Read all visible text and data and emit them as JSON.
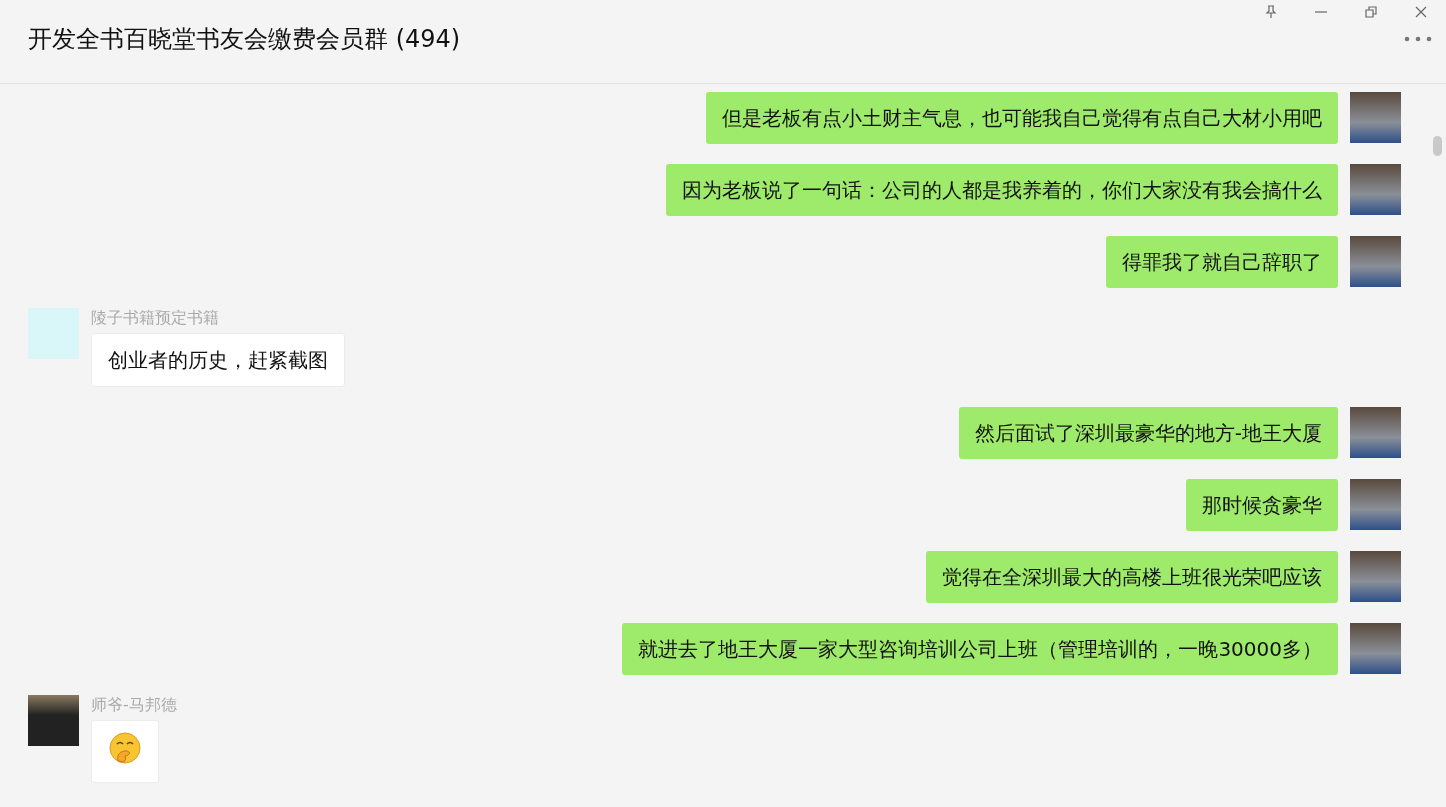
{
  "window": {
    "title": "开发全书百晓堂书友会缴费会员群 (494)"
  },
  "messages": [
    {
      "kind": "mine",
      "text": "但是老板有点小土财主气息，也可能我自己觉得有点自己大材小用吧"
    },
    {
      "kind": "mine",
      "text": "因为老板说了一句话：公司的人都是我养着的，你们大家没有我会搞什么"
    },
    {
      "kind": "mine",
      "text": "得罪我了就自己辞职了"
    },
    {
      "kind": "other",
      "sender": "陵子书籍预定书籍",
      "text": "创业者的历史，赶紧截图"
    },
    {
      "kind": "mine",
      "text": "然后面试了深圳最豪华的地方-地王大厦"
    },
    {
      "kind": "mine",
      "text": "那时候贪豪华"
    },
    {
      "kind": "mine",
      "text": "觉得在全深圳最大的高楼上班很光荣吧应该"
    },
    {
      "kind": "mine",
      "text": "就进去了地王大厦一家大型咨询培训公司上班（管理培训的，一晚30000多）"
    },
    {
      "kind": "other-emoji",
      "sender": "师爷-马邦德"
    }
  ]
}
